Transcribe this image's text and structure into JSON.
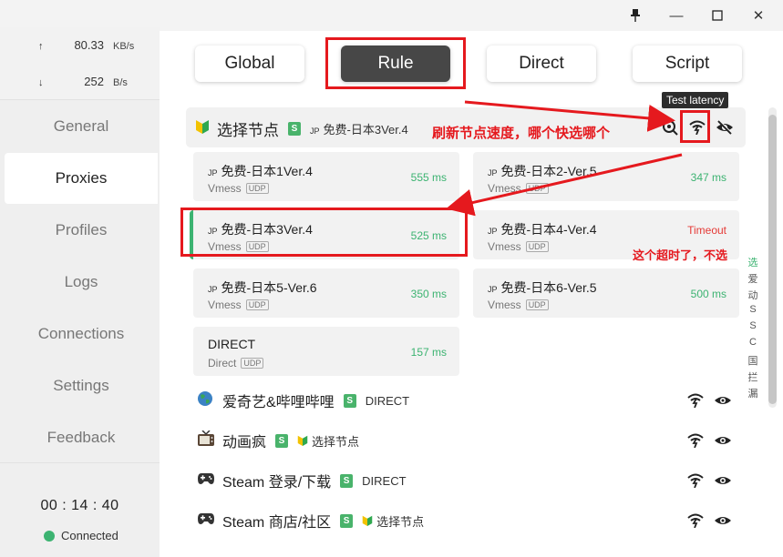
{
  "window": {
    "pin_icon": "pin-icon",
    "min_label": "—",
    "max_label": "☐",
    "close_label": "✕"
  },
  "traffic": {
    "up_arrow": "↑",
    "up_value": "80.33",
    "up_unit": "KB/s",
    "down_arrow": "↓",
    "down_value": "252",
    "down_unit": "B/s"
  },
  "nav": {
    "items": [
      {
        "label": "General"
      },
      {
        "label": "Proxies"
      },
      {
        "label": "Profiles"
      },
      {
        "label": "Logs"
      },
      {
        "label": "Connections"
      },
      {
        "label": "Settings"
      },
      {
        "label": "Feedback"
      }
    ]
  },
  "clock": "00 : 14 : 40",
  "connection_status": "Connected",
  "modes": [
    "Global",
    "Rule",
    "Direct",
    "Script"
  ],
  "tooltip": "Test latency",
  "group": {
    "name": "选择节点",
    "badge": "S",
    "selected_prefix": "JP",
    "selected": "免费-日本3Ver.4"
  },
  "proxies": [
    {
      "prefix": "JP",
      "name": "免费-日本1Ver.4",
      "type": "Vmess",
      "udp": "UDP",
      "latency": "555 ms"
    },
    {
      "prefix": "JP",
      "name": "免费-日本2-Ver.5",
      "type": "Vmess",
      "udp": "UDP",
      "latency": "347 ms"
    },
    {
      "prefix": "JP",
      "name": "免费-日本3Ver.4",
      "type": "Vmess",
      "udp": "UDP",
      "latency": "525 ms"
    },
    {
      "prefix": "JP",
      "name": "免费-日本4-Ver.4",
      "type": "Vmess",
      "udp": "UDP",
      "latency": "Timeout"
    },
    {
      "prefix": "JP",
      "name": "免费-日本5-Ver.6",
      "type": "Vmess",
      "udp": "UDP",
      "latency": "350 ms"
    },
    {
      "prefix": "JP",
      "name": "免费-日本6-Ver.5",
      "type": "Vmess",
      "udp": "UDP",
      "latency": "500 ms"
    },
    {
      "prefix": "",
      "name": "DIRECT",
      "type": "Direct",
      "udp": "UDP",
      "latency": "157 ms"
    }
  ],
  "groups": [
    {
      "icon": "globe-icon",
      "name": "爱奇艺&哔哩哔哩",
      "badge": "S",
      "selected": "DIRECT"
    },
    {
      "icon": "tv-icon",
      "name": "动画疯",
      "badge": "S",
      "selected": "选择节点"
    },
    {
      "icon": "gamepad-icon",
      "name": "Steam 登录/下载",
      "badge": "S",
      "selected": "DIRECT"
    },
    {
      "icon": "gamepad-icon",
      "name": "Steam 商店/社区",
      "badge": "S",
      "selected": "选择节点"
    }
  ],
  "side_chars": [
    "选",
    "爱",
    "动",
    "S",
    "S",
    "C",
    "国",
    "拦",
    "漏"
  ],
  "annotations": {
    "refresh_note": "刷新节点速度，哪个快选哪个",
    "timeout_note": "这个超时了，不选"
  },
  "colors": {
    "accent_green": "#3cb371",
    "annotation_red": "#e5191e",
    "active_mode_bg": "#474747"
  }
}
